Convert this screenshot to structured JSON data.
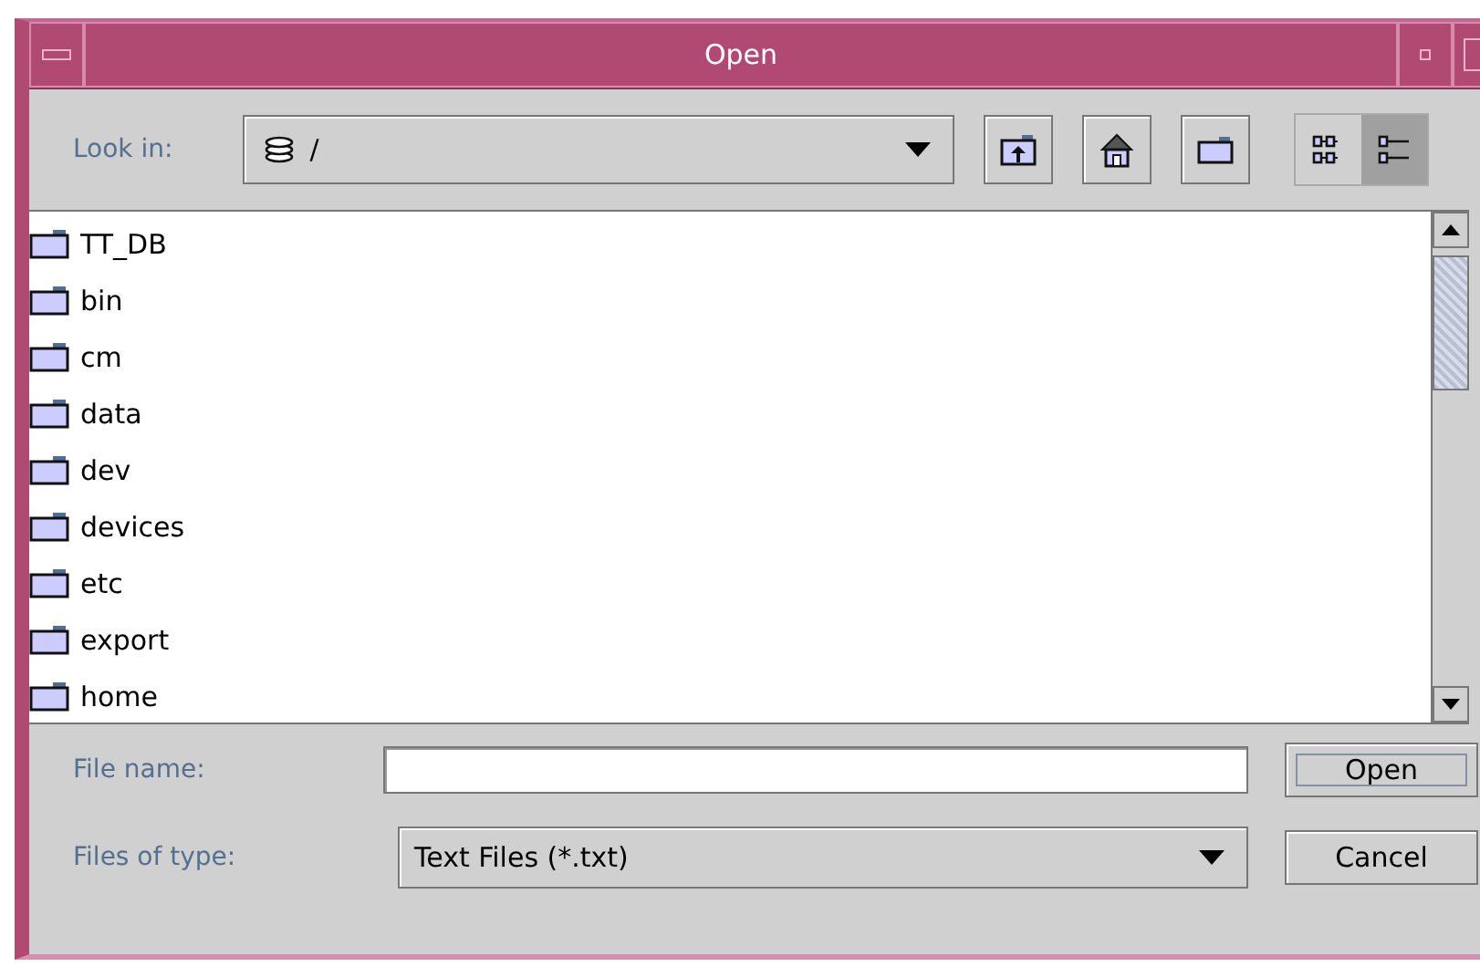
{
  "window": {
    "title": "Open"
  },
  "look_in": {
    "label": "Look in:",
    "value": "/"
  },
  "toolbar": [
    {
      "kind": "up"
    },
    {
      "kind": "home"
    },
    {
      "kind": "newfolder"
    }
  ],
  "view_modes": [
    {
      "kind": "list",
      "selected": false
    },
    {
      "kind": "details",
      "selected": true
    }
  ],
  "files": [
    {
      "name": "TT_DB"
    },
    {
      "name": "bin"
    },
    {
      "name": "cm"
    },
    {
      "name": "data"
    },
    {
      "name": "dev"
    },
    {
      "name": "devices"
    },
    {
      "name": "etc"
    },
    {
      "name": "export"
    },
    {
      "name": "home"
    }
  ],
  "file_name": {
    "label": "File name:"
  },
  "file_type": {
    "label": "Files of type:",
    "value": "Text Files (*.txt)"
  },
  "buttons": [
    {
      "label": "Open",
      "focused": true
    },
    {
      "label": "Cancel",
      "focused": false
    }
  ]
}
